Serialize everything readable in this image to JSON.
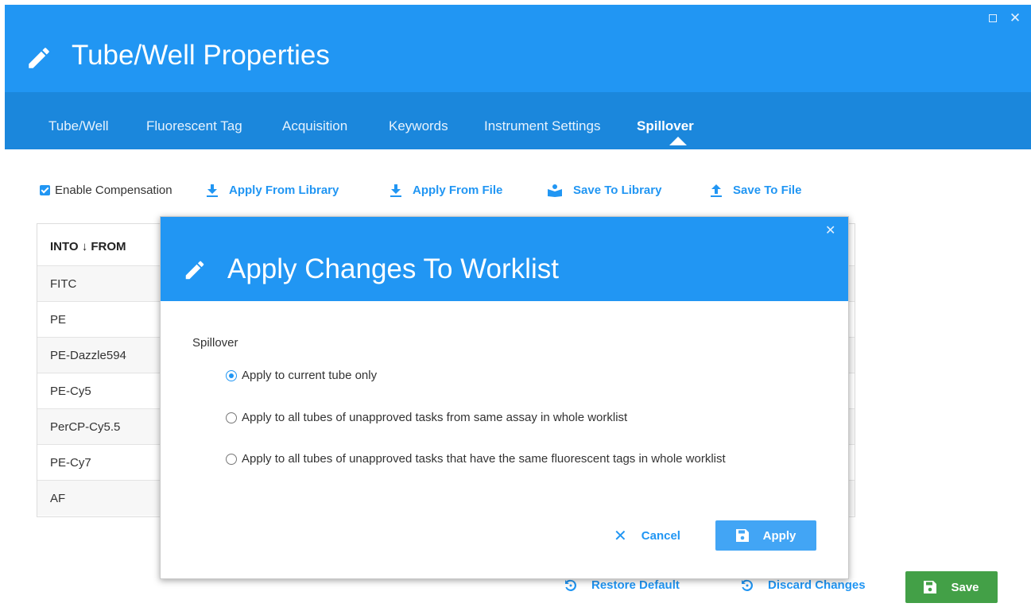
{
  "window": {
    "title": "Tube/Well Properties",
    "maximize_icon": "maximize-icon",
    "close_icon": "close-icon"
  },
  "tabs": [
    {
      "label": "Tube/Well",
      "active": false
    },
    {
      "label": "Fluorescent Tag",
      "active": false
    },
    {
      "label": "Acquisition",
      "active": false
    },
    {
      "label": "Keywords",
      "active": false
    },
    {
      "label": "Instrument Settings",
      "active": false
    },
    {
      "label": "Spillover",
      "active": true
    }
  ],
  "toolbar": {
    "enable_compensation": {
      "label": "Enable Compensation",
      "checked": true
    },
    "apply_from_library": "Apply From Library",
    "apply_from_file": "Apply From File",
    "save_to_library": "Save To Library",
    "save_to_file": "Save To File"
  },
  "table": {
    "header": "INTO ↓ FROM",
    "rows": [
      "FITC",
      "PE",
      "PE-Dazzle594",
      "PE-Cy5",
      "PerCP-Cy5.5",
      "PE-Cy7",
      "AF"
    ]
  },
  "footer": {
    "restore_default": "Restore Default",
    "discard_changes": "Discard Changes",
    "save": "Save"
  },
  "modal": {
    "title": "Apply Changes To Worklist",
    "section_label": "Spillover",
    "options": [
      {
        "label": "Apply to current tube only",
        "selected": true
      },
      {
        "label": "Apply to all tubes of unapproved tasks from same assay in whole worklist",
        "selected": false
      },
      {
        "label": "Apply to all tubes of unapproved tasks that have the same fluorescent tags in whole worklist",
        "selected": false
      }
    ],
    "cancel": "Cancel",
    "apply": "Apply"
  },
  "colors": {
    "header_blue": "#2196f3",
    "tab_bar_blue": "#1b87dc",
    "save_green": "#43a047",
    "apply_blue": "#42a5f5"
  }
}
